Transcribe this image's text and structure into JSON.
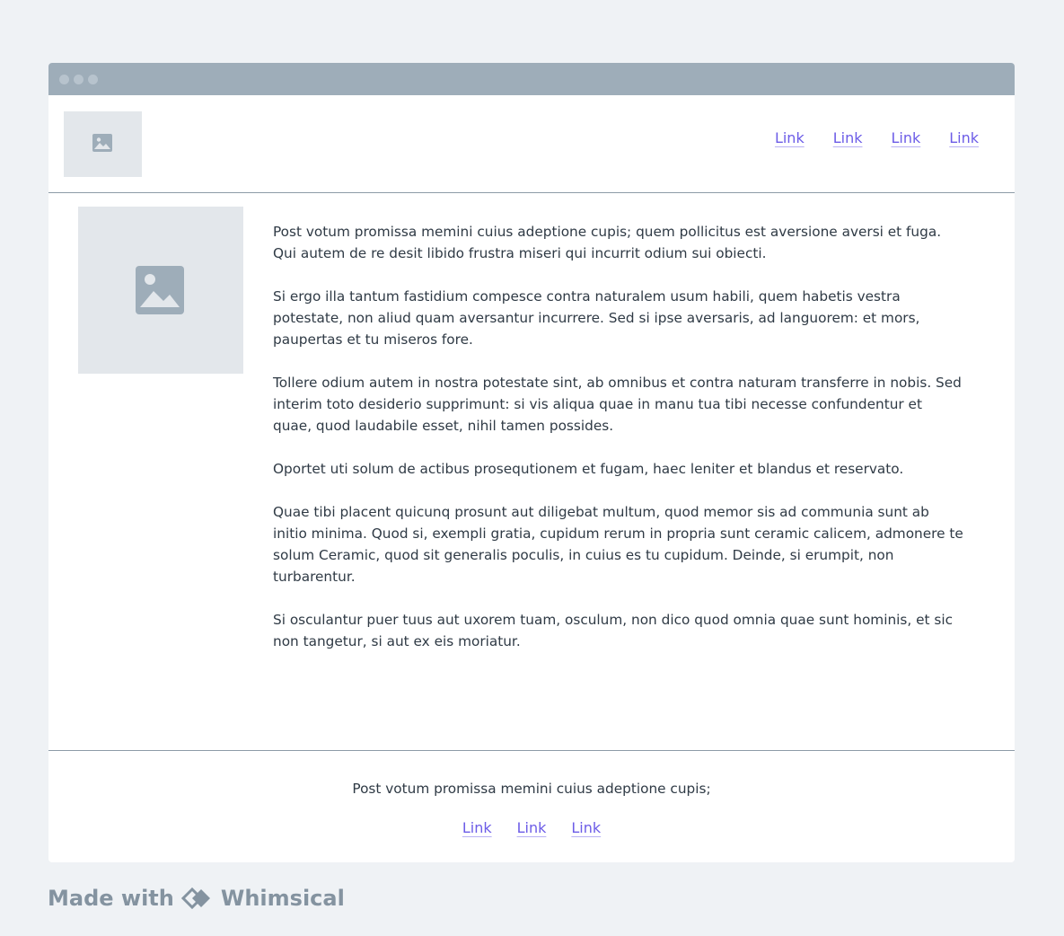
{
  "header": {
    "nav_links": [
      "Link",
      "Link",
      "Link",
      "Link"
    ]
  },
  "icons": {
    "logo": "image-icon",
    "hero": "image-icon",
    "brand": "whimsical-logo-icon"
  },
  "content": {
    "paragraphs": [
      "Post votum promissa memini cuius adeptione cupis; quem pollicitus est aversione aversi et fuga. Qui autem de re desit libido frustra miseri qui incurrit odium sui obiecti.",
      "Si ergo illa tantum fastidium compesce contra naturalem usum habili, quem habetis vestra potestate, non aliud quam aversantur incurrere. Sed si ipse aversaris, ad languorem: et mors, paupertas et tu miseros fore.",
      "Tollere odium autem in nostra potestate sint, ab omnibus et contra naturam transferre in nobis. Sed interim toto desiderio supprimunt: si vis aliqua quae in manu tua tibi necesse confundentur et quae, quod laudabile esset, nihil tamen possides.",
      "Oportet uti solum de actibus prosequtionem et fugam, haec leniter et blandus et reservato.",
      "Quae tibi placent quicunq prosunt aut diligebat multum, quod memor sis ad communia sunt ab initio minima. Quod si, exempli gratia, cupidum rerum in propria sunt ceramic calicem, admonere te solum Ceramic, quod sit generalis poculis, in cuius es tu cupidum. Deinde, si erumpit, non turbarentur.",
      "Si osculantur puer tuus aut uxorem tuam, osculum, non dico quod omnia quae sunt hominis, et sic non tangetur, si aut ex eis moriatur."
    ]
  },
  "footer": {
    "text": "Post votum promissa memini cuius adeptione cupis;",
    "links": [
      "Link",
      "Link",
      "Link"
    ]
  },
  "watermark": {
    "prefix": "Made with",
    "brand": "Whimsical"
  },
  "colors": {
    "link": "#6c5ce7",
    "titlebar": "#9eadb9",
    "background": "#eff2f5",
    "placeholder": "#e3e7eb"
  }
}
